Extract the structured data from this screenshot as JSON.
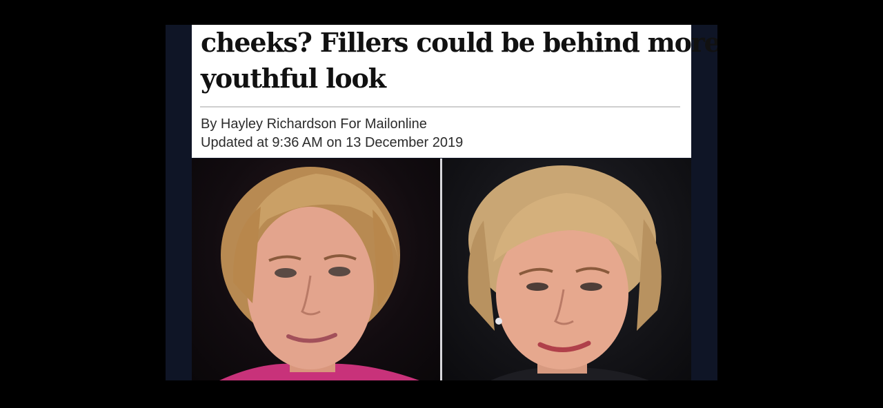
{
  "article": {
    "headline_line1": "cheeks? Fillers could be behind more",
    "headline_line2": "youthful look",
    "byline": "By Hayley Richardson For Mailonline",
    "updated": "Updated at 9:36 AM on 13 December 2019"
  },
  "colors": {
    "frame_background": "#000000",
    "panel_background": "#ffffff",
    "headline_text": "#111111",
    "byline_text": "#2b2b2b"
  }
}
